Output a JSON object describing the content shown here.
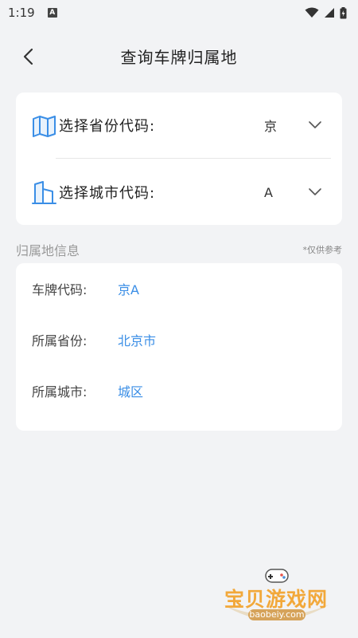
{
  "status_bar": {
    "time": "1:19",
    "notif_icon_letter": "A"
  },
  "header": {
    "title": "查询车牌归属地",
    "back_icon": "chevron-left-icon"
  },
  "selectors": [
    {
      "label": "选择省份代码:",
      "value": "京",
      "icon": "map-icon"
    },
    {
      "label": "选择城市代码:",
      "value": "A",
      "icon": "city-building-icon"
    }
  ],
  "info_section": {
    "title": "归属地信息",
    "note": "*仅供参考",
    "rows": [
      {
        "label": "车牌代码:",
        "value": "京A"
      },
      {
        "label": "所属省份:",
        "value": "北京市"
      },
      {
        "label": "所属城市:",
        "value": "城区"
      }
    ]
  },
  "watermark": {
    "text": "宝贝游戏网",
    "url": "baobeiy.com"
  },
  "colors": {
    "accent": "#3a8ee6",
    "background": "#f2f3f5",
    "card": "#ffffff",
    "watermark": "#f2a83a"
  }
}
